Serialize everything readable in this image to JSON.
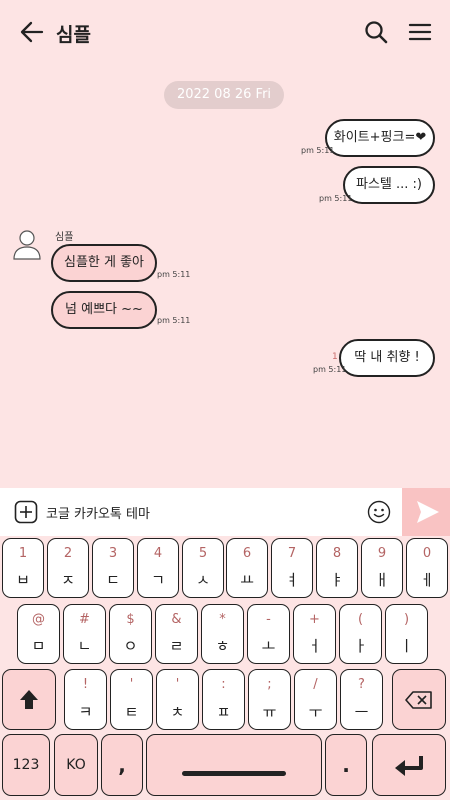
{
  "header": {
    "title": "심플",
    "back_icon": "arrow-left-icon",
    "search_icon": "search-icon",
    "menu_icon": "hamburger-menu-icon"
  },
  "chat": {
    "date": "2022 08 26 Fri",
    "sender_name": "심플",
    "messages": [
      {
        "direction": "out",
        "text": "화이트+핑크=❤",
        "time": "pm 5:11"
      },
      {
        "direction": "out",
        "text": "파스텔 ... :)",
        "time": "pm 5:11"
      },
      {
        "direction": "in",
        "text": "심플한 게 좋아",
        "time": "pm 5:11"
      },
      {
        "direction": "in",
        "text": "넘 예쁘다 ~~",
        "time": "pm 5:11"
      },
      {
        "direction": "out",
        "text": "딱 내 취향 !",
        "time": "pm 5:11",
        "unread": "1"
      }
    ]
  },
  "input": {
    "value": "코글 카카오톡 테마",
    "plus_icon": "plus-square-icon",
    "emoji_icon": "smiley-icon",
    "send_icon": "send-triangle-icon"
  },
  "keyboard": {
    "row1": [
      {
        "hint": "1",
        "main": "ㅂ"
      },
      {
        "hint": "2",
        "main": "ㅈ"
      },
      {
        "hint": "3",
        "main": "ㄷ"
      },
      {
        "hint": "4",
        "main": "ㄱ"
      },
      {
        "hint": "5",
        "main": "ㅅ"
      },
      {
        "hint": "6",
        "main": "ㅛ"
      },
      {
        "hint": "7",
        "main": "ㅕ"
      },
      {
        "hint": "8",
        "main": "ㅑ"
      },
      {
        "hint": "9",
        "main": "ㅐ"
      },
      {
        "hint": "0",
        "main": "ㅔ"
      }
    ],
    "row2": [
      {
        "hint": "@",
        "main": "ㅁ"
      },
      {
        "hint": "#",
        "main": "ㄴ"
      },
      {
        "hint": "$",
        "main": "ㅇ"
      },
      {
        "hint": "&",
        "main": "ㄹ"
      },
      {
        "hint": "*",
        "main": "ㅎ"
      },
      {
        "hint": "-",
        "main": "ㅗ"
      },
      {
        "hint": "+",
        "main": "ㅓ"
      },
      {
        "hint": "(",
        "main": "ㅏ"
      },
      {
        "hint": ")",
        "main": "ㅣ"
      }
    ],
    "row3": [
      {
        "hint": "!",
        "main": "ㅋ"
      },
      {
        "hint": "'",
        "main": "ㅌ"
      },
      {
        "hint": "'",
        "main": "ㅊ"
      },
      {
        "hint": ":",
        "main": "ㅍ"
      },
      {
        "hint": ";",
        "main": "ㅠ"
      },
      {
        "hint": "/",
        "main": "ㅜ"
      },
      {
        "hint": "?",
        "main": "ㅡ"
      }
    ],
    "shift_icon": "shift-arrow-icon",
    "backspace_icon": "backspace-icon",
    "numbers_label": "123",
    "lang_label": "KO",
    "comma_label": ",",
    "period_label": ".",
    "space_icon": "spacebar-icon",
    "enter_icon": "enter-arrow-icon"
  }
}
